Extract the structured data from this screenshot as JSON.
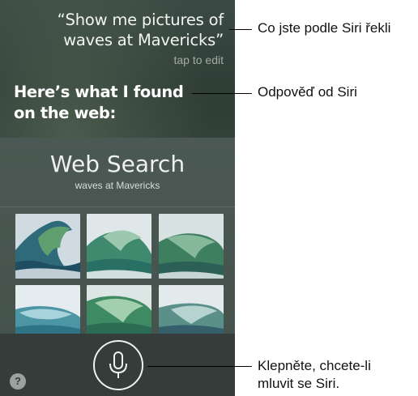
{
  "siri": {
    "user_query": "“Show me pictures of waves at Mavericks”",
    "tap_to_edit": "tap to edit",
    "response": "Here’s what I found on the web:",
    "card": {
      "title": "Web Search",
      "subtitle": "waves at Mavericks",
      "images": [
        {
          "icon": "wave-photo-icon"
        },
        {
          "icon": "wave-photo-icon"
        },
        {
          "icon": "wave-photo-icon"
        },
        {
          "icon": "wave-photo-icon"
        },
        {
          "icon": "wave-photo-icon"
        },
        {
          "icon": "wave-photo-icon"
        }
      ]
    },
    "help_label": "?",
    "mic_icon": "microphone-icon"
  },
  "callouts": {
    "what_you_said": "Co jste podle Siri řekli",
    "siri_response": "Odpověď od Siri",
    "tap_to_speak_line1": "Klepněte, chcete-li",
    "tap_to_speak_line2": "mluvit se Siri."
  },
  "colors": {
    "screen_bg": "#33413b",
    "card_bg": "#4b5853",
    "bottom_bar": "#343d39",
    "text_light": "#f2f4f2",
    "text_muted": "#a4aca7"
  }
}
